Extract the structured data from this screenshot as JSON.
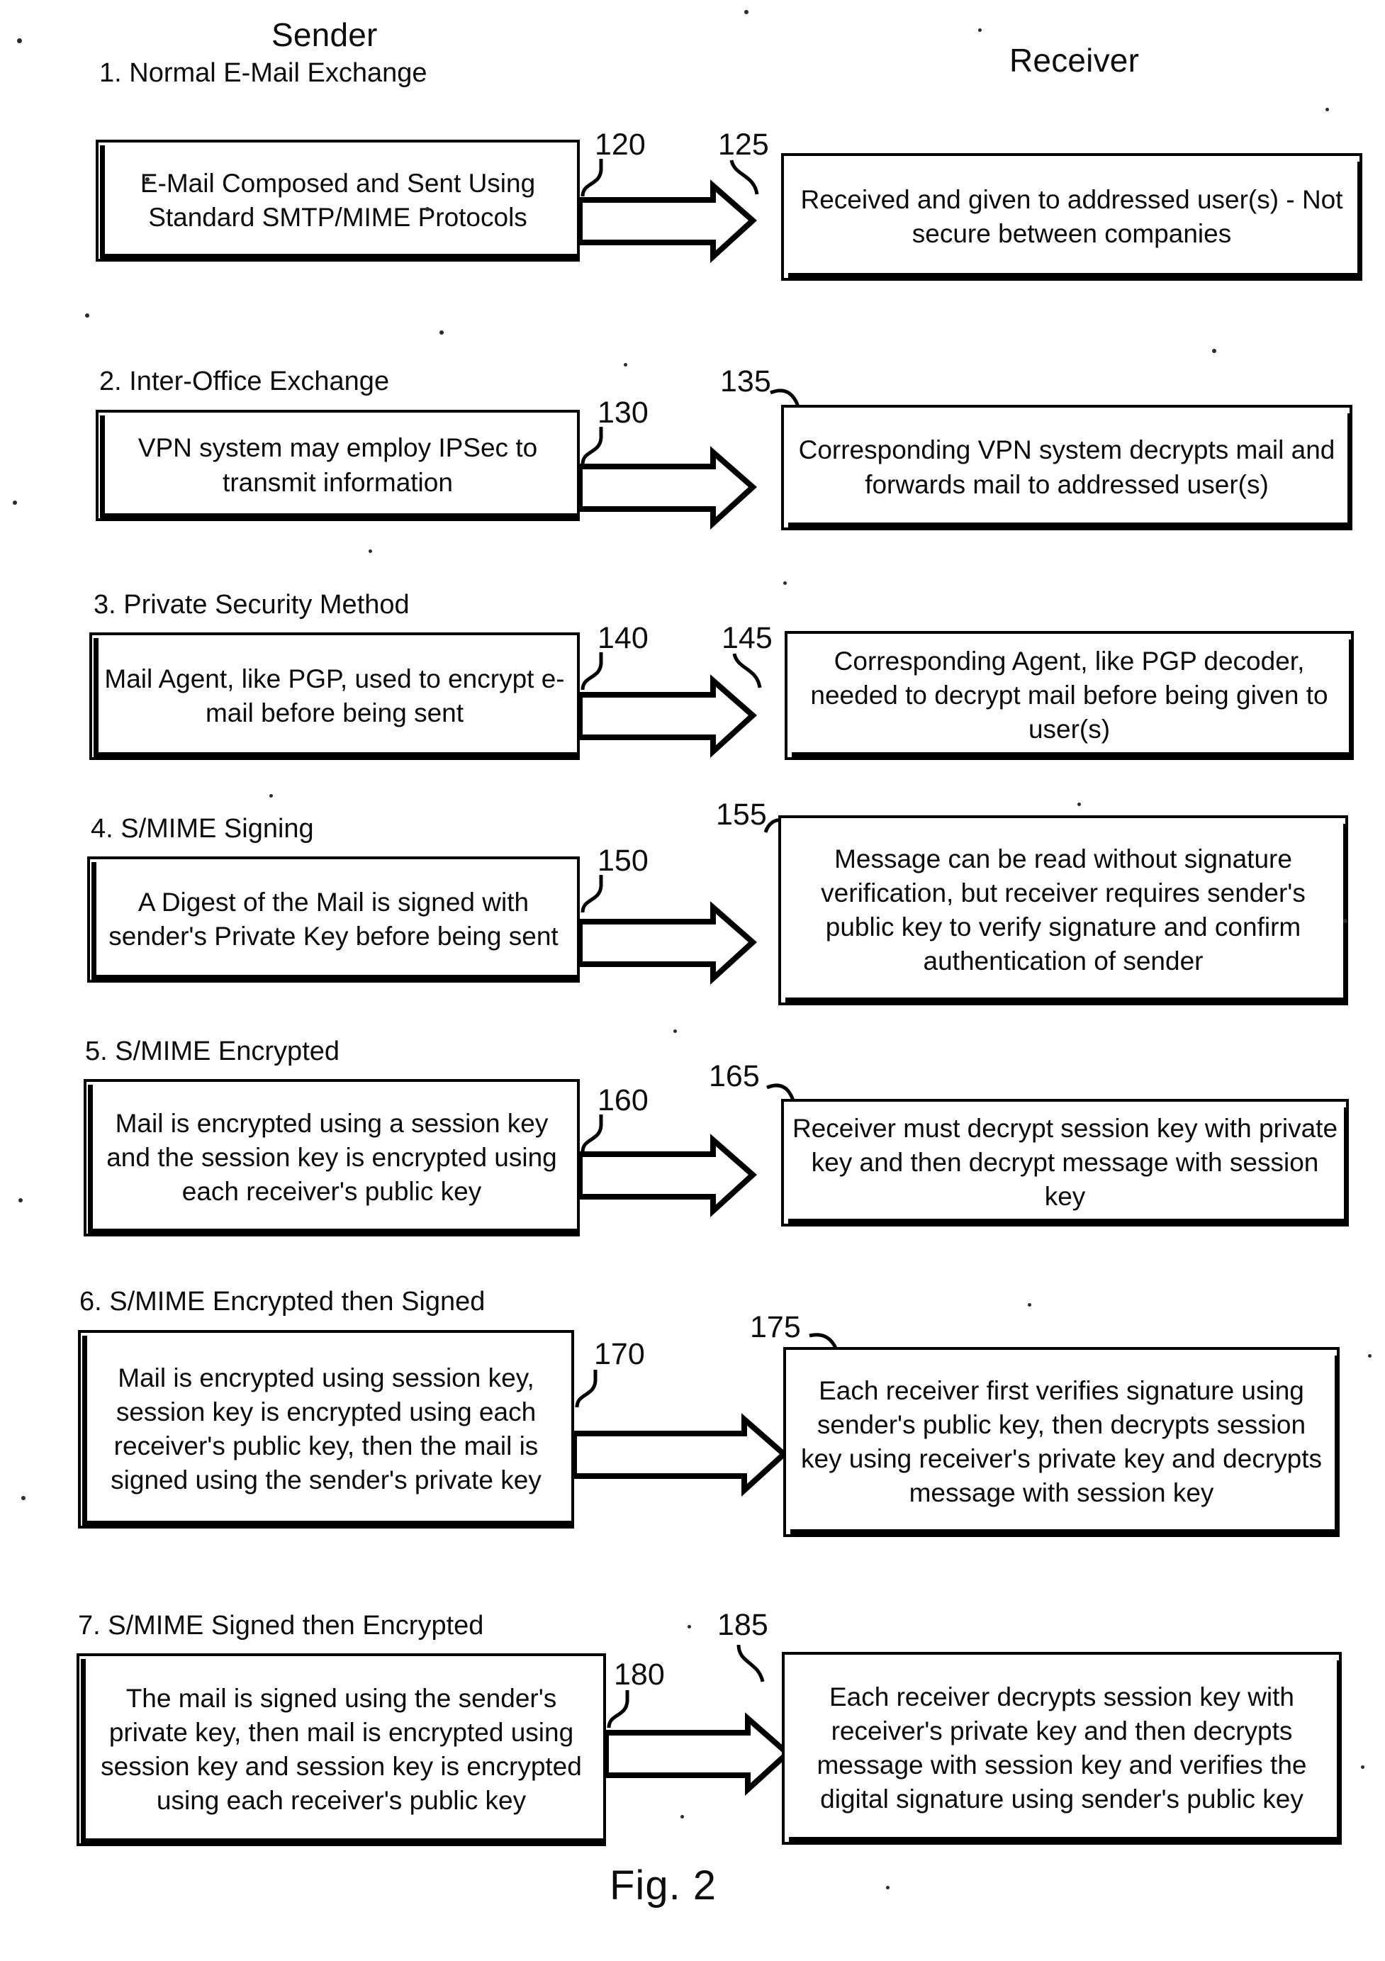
{
  "figure": {
    "caption": "Fig. 2",
    "columns": {
      "sender": "Sender",
      "receiver": "Receiver"
    }
  },
  "sections": [
    {
      "heading": "1. Normal E-Mail Exchange",
      "sender_ref": "120",
      "receiver_ref": "125",
      "sender_text": "E-Mail Composed and Sent Using Standard SMTP/MIME Protocols",
      "receiver_text": "Received and given to addressed user(s) - Not secure between companies"
    },
    {
      "heading": "2. Inter-Office Exchange",
      "sender_ref": "130",
      "receiver_ref": "135",
      "sender_text": "VPN system may employ IPSec to transmit information",
      "receiver_text": "Corresponding VPN system decrypts mail and forwards mail to addressed user(s)"
    },
    {
      "heading": "3. Private Security Method",
      "sender_ref": "140",
      "receiver_ref": "145",
      "sender_text": "Mail Agent, like PGP, used to encrypt e-mail before being sent",
      "receiver_text": "Corresponding Agent, like PGP decoder, needed to decrypt mail before being given to user(s)"
    },
    {
      "heading": "4. S/MIME Signing",
      "sender_ref": "150",
      "receiver_ref": "155",
      "sender_text": "A Digest of the Mail is signed with sender's Private Key before being sent",
      "receiver_text": "Message can be read without signature verification, but receiver requires sender's public key to verify signature and confirm authentication of sender"
    },
    {
      "heading": "5. S/MIME Encrypted",
      "sender_ref": "160",
      "receiver_ref": "165",
      "sender_text": "Mail is encrypted using a session key and the session key is encrypted using each receiver's public key",
      "receiver_text": "Receiver must decrypt session key with private key and then decrypt message with session key"
    },
    {
      "heading": "6. S/MIME Encrypted then Signed",
      "sender_ref": "170",
      "receiver_ref": "175",
      "sender_text": "Mail is encrypted using session key, session key is encrypted using each receiver's public key, then the mail is signed using the sender's private key",
      "receiver_text": "Each receiver first verifies signature using sender's public key, then decrypts session key using receiver's private key and decrypts message with session key"
    },
    {
      "heading": "7. S/MIME Signed then Encrypted",
      "sender_ref": "180",
      "receiver_ref": "185",
      "sender_text": "The mail is signed using the sender's private key, then mail is encrypted using session key and session key is encrypted using each receiver's public key",
      "receiver_text": "Each receiver decrypts session key with receiver's private key and then decrypts message with session key and verifies the digital signature using sender's public key"
    }
  ]
}
